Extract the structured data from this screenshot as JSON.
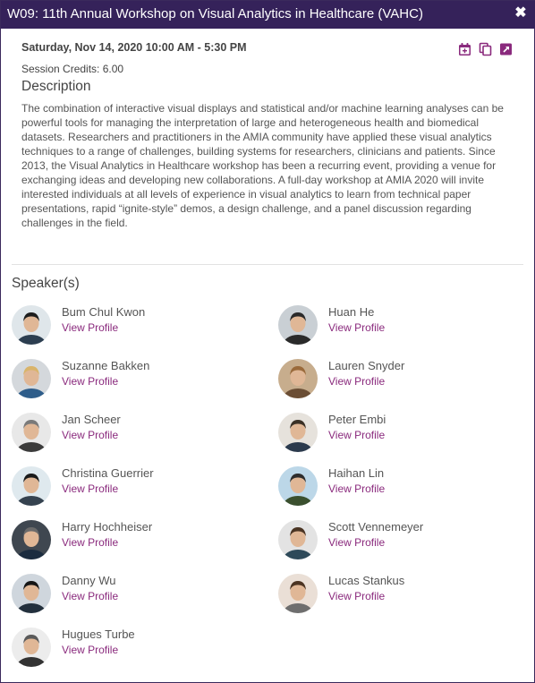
{
  "window": {
    "title": "W09: 11th Annual Workshop on Visual Analytics in Healthcare (VAHC)",
    "close_icon": "close-icon"
  },
  "session": {
    "datetime": "Saturday, Nov 14, 2020 10:00 AM - 5:30 PM",
    "credits": "Session Credits: 6.00",
    "tools": [
      "add-to-calendar-icon",
      "copy-icon",
      "external-link-icon"
    ],
    "accent_color": "#8a2a7d"
  },
  "description": {
    "heading": "Description",
    "text": "The combination of interactive visual displays and statistical and/or machine learning analyses can be powerful tools for managing the interpretation of large and heterogeneous health and biomedical datasets. Researchers and practitioners in the AMIA community have applied these visual analytics techniques to a range of challenges, building systems for researchers, clinicians and patients. Since 2013, the Visual Analytics in Healthcare workshop has been a recurring event, providing a venue for exchanging ideas and developing new collaborations. A full-day workshop at AMIA 2020 will invite interested individuals at all levels of experience in visual analytics to learn from technical paper presentations, rapid “ignite-style” demos, a design challenge, and a panel discussion regarding challenges in the field."
  },
  "speakers": {
    "heading": "Speaker(s)",
    "link_label": "View Profile",
    "items": [
      {
        "name": "Bum Chul Kwon"
      },
      {
        "name": "Huan He"
      },
      {
        "name": "Suzanne Bakken"
      },
      {
        "name": "Lauren Snyder"
      },
      {
        "name": "Jan Scheer"
      },
      {
        "name": "Peter Embi"
      },
      {
        "name": "Christina Guerrier"
      },
      {
        "name": "Haihan Lin"
      },
      {
        "name": "Harry Hochheiser"
      },
      {
        "name": "Scott Vennemeyer"
      },
      {
        "name": "Danny Wu"
      },
      {
        "name": "Lucas Stankus"
      },
      {
        "name": "Hugues Turbe"
      }
    ]
  }
}
